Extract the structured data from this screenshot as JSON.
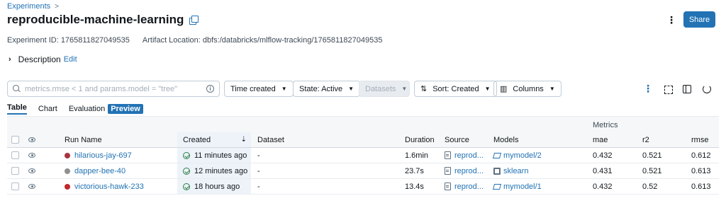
{
  "breadcrumb": {
    "parent": "Experiments",
    "separator": ">"
  },
  "experiment": {
    "title": "reproducible-machine-learning",
    "id_label": "Experiment ID:",
    "id_value": "1765811827049535",
    "artifact_label": "Artifact Location:",
    "artifact_value": "dbfs:/databricks/mlflow-tracking/1765811827049535"
  },
  "header": {
    "share_label": "Share",
    "kebab_glyph": "⋮"
  },
  "description": {
    "label": "Description",
    "edit_label": "Edit"
  },
  "toolbar": {
    "search_placeholder": "metrics.rmse < 1 and params.model = \"tree\"",
    "time_created": "Time created",
    "state": "State: Active",
    "datasets": "Datasets",
    "sort": "Sort: Created",
    "columns": "Columns"
  },
  "tabs": [
    {
      "label": "Table",
      "active": true
    },
    {
      "label": "Chart",
      "active": false
    },
    {
      "label": "Evaluation",
      "active": false
    }
  ],
  "preview_badge": "Preview",
  "table": {
    "group_header": "Metrics",
    "columns": [
      "Run Name",
      "Created",
      "Dataset",
      "Duration",
      "Source",
      "Models",
      "mae",
      "r2",
      "rmse"
    ],
    "rows": [
      {
        "name": "hilarious-jay-697",
        "color": "#a8353f",
        "created": "11 minutes ago",
        "dataset": "-",
        "duration": "1.6min",
        "source": "reprod...",
        "model": "mymodel/2",
        "model_icon": "model-icon",
        "mae": "0.432",
        "r2": "0.521",
        "rmse": "0.612"
      },
      {
        "name": "dapper-bee-40",
        "color": "#8f8f8f",
        "created": "12 minutes ago",
        "dataset": "-",
        "duration": "23.7s",
        "source": "reprod...",
        "model": "sklearn",
        "model_icon": "sklearn-icon",
        "mae": "0.431",
        "r2": "0.521",
        "rmse": "0.613"
      },
      {
        "name": "victorious-hawk-233",
        "color": "#c0282e",
        "created": "18 hours ago",
        "dataset": "-",
        "duration": "13.4s",
        "source": "reprod...",
        "model": "mymodel/1",
        "model_icon": "model-icon",
        "mae": "0.432",
        "r2": "0.52",
        "rmse": "0.613"
      }
    ]
  }
}
